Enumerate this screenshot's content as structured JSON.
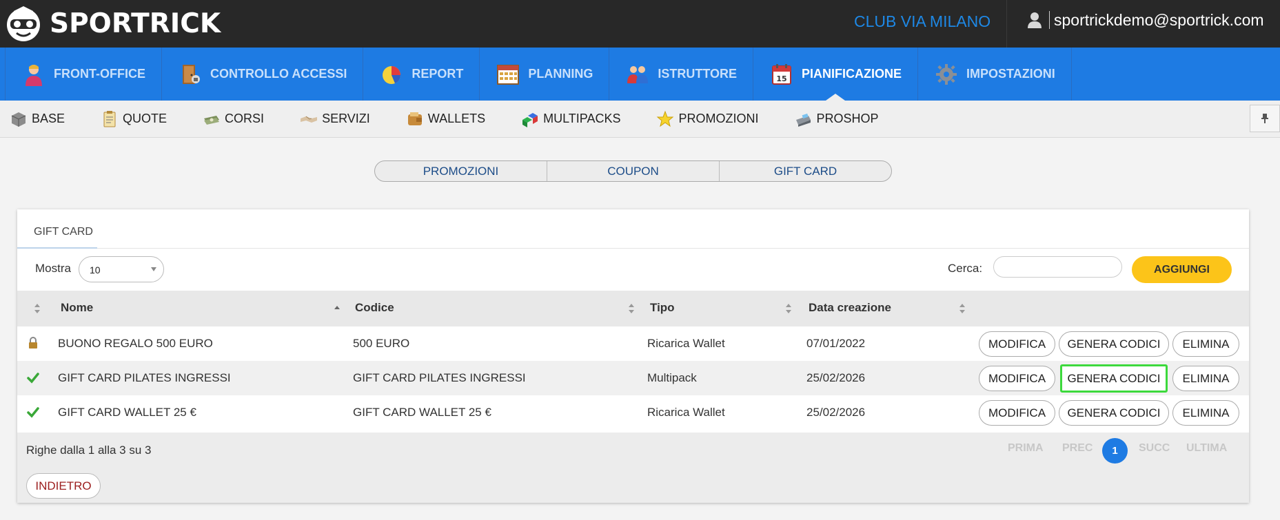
{
  "brand": {
    "name": "SPORTRICK",
    "logo_icon": "goggles-mascot-icon"
  },
  "header": {
    "club": "CLUB VIA MILANO",
    "user_email": "sportrickdemo@sportrick.com",
    "user_icon": "user-icon"
  },
  "main_nav": [
    {
      "label": "FRONT-OFFICE",
      "icon": "receptionist-icon"
    },
    {
      "label": "CONTROLLO ACCESSI",
      "icon": "door-access-icon"
    },
    {
      "label": "REPORT",
      "icon": "pie-chart-icon"
    },
    {
      "label": "PLANNING",
      "icon": "calendar-grid-icon"
    },
    {
      "label": "ISTRUTTORE",
      "icon": "people-icon"
    },
    {
      "label": "PIANIFICAZIONE",
      "icon": "calendar-icon",
      "active": true
    },
    {
      "label": "IMPOSTAZIONI",
      "icon": "gear-icon"
    }
  ],
  "sub_nav": [
    {
      "label": "BASE",
      "icon": "box-icon"
    },
    {
      "label": "QUOTE",
      "icon": "clipboard-icon"
    },
    {
      "label": "CORSI",
      "icon": "money-icon"
    },
    {
      "label": "SERVIZI",
      "icon": "handshake-icon"
    },
    {
      "label": "WALLETS",
      "icon": "wallet-icon"
    },
    {
      "label": "MULTIPACKS",
      "icon": "cubes-icon"
    },
    {
      "label": "PROMOZIONI",
      "icon": "star-icon"
    },
    {
      "label": "PROSHOP",
      "icon": "cash-register-icon"
    }
  ],
  "tabs": [
    "PROMOZIONI",
    "COUPON",
    "GIFT CARD"
  ],
  "panel": {
    "title": "GIFT CARD",
    "mostra_label": "Mostra",
    "mostra_value": "10",
    "cerca_label": "Cerca:",
    "cerca_value": "",
    "add_label": "AGGIUNGI"
  },
  "table": {
    "columns": [
      "Nome",
      "Codice",
      "Tipo",
      "Data creazione"
    ],
    "rows": [
      {
        "status": "lock-icon",
        "nome": "BUONO REGALO 500 EURO",
        "codice": "500 EURO",
        "tipo": "Ricarica Wallet",
        "data": "07/01/2022"
      },
      {
        "status": "check-icon",
        "nome": "GIFT CARD PILATES INGRESSI",
        "codice": "GIFT CARD PILATES INGRESSI",
        "tipo": "Multipack",
        "data": "25/02/2026"
      },
      {
        "status": "check-icon",
        "nome": "GIFT CARD WALLET 25 €",
        "codice": "GIFT CARD WALLET 25 €",
        "tipo": "Ricarica Wallet",
        "data": "25/02/2026"
      }
    ],
    "row_actions": [
      "MODIFICA",
      "GENERA CODICI",
      "ELIMINA"
    ],
    "info": "Righe dalla 1 alla 3 su 3",
    "pager": {
      "first": "PRIMA",
      "prev": "PREC",
      "current": "1",
      "next": "SUCC",
      "last": "ULTIMA"
    },
    "back_label": "INDIETRO"
  },
  "colors": {
    "topbar": "#282828",
    "nav": "#1e7be3",
    "accent_yellow": "#fcc419",
    "highlight": "#3cd93c"
  }
}
